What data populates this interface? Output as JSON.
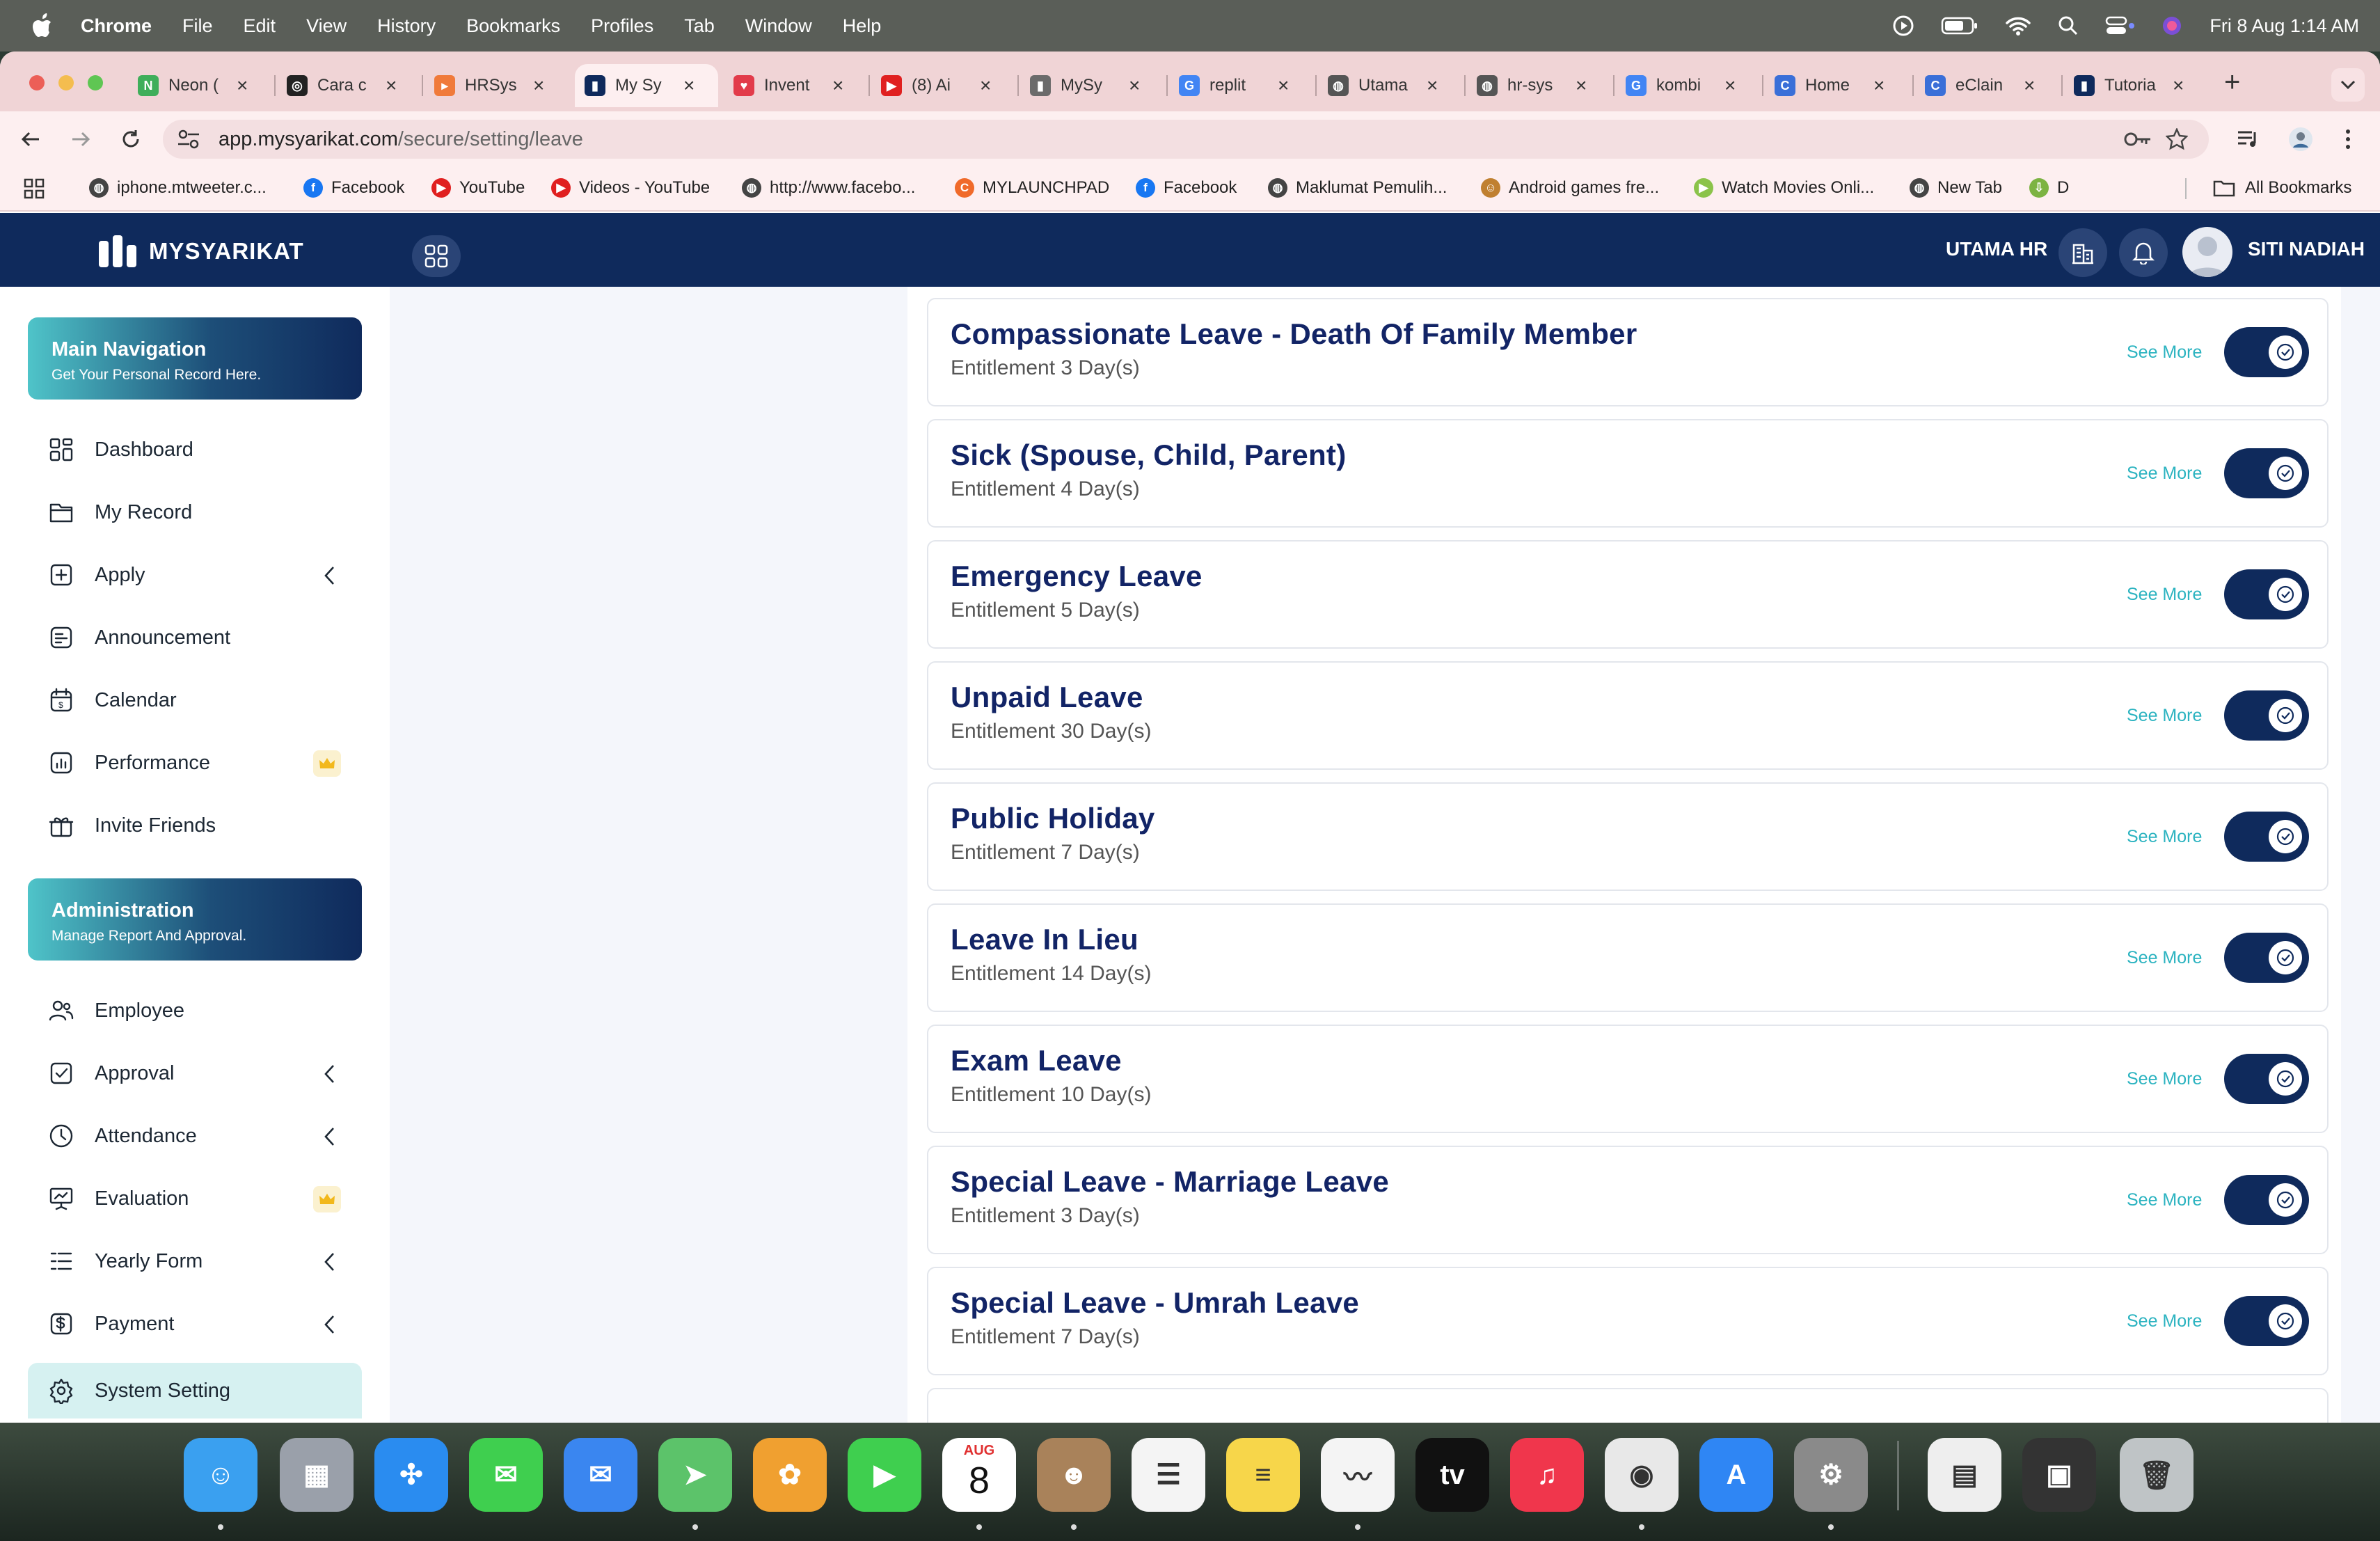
{
  "menubar": {
    "app": "Chrome",
    "items": [
      "File",
      "Edit",
      "View",
      "History",
      "Bookmarks",
      "Profiles",
      "Tab",
      "Window",
      "Help"
    ],
    "clock": "Fri 8 Aug  1:14 AM"
  },
  "tabs": [
    {
      "title": "Neon (",
      "color": "#3fae5a",
      "glyph": "N"
    },
    {
      "title": "Cara c",
      "color": "#222222",
      "glyph": "◎"
    },
    {
      "title": "HRSys",
      "color": "#f07a3a",
      "glyph": "▸"
    },
    {
      "title": "My Sy",
      "color": "#0f2a5c",
      "glyph": "▮"
    },
    {
      "title": "Invent",
      "color": "#e23b4a",
      "glyph": "♥"
    },
    {
      "title": "(8) Ai",
      "color": "#e02020",
      "glyph": "▶"
    },
    {
      "title": "MySy",
      "color": "#6b6b6b",
      "glyph": "▮"
    },
    {
      "title": "replit",
      "color": "#4285f4",
      "glyph": "G"
    },
    {
      "title": "Utama",
      "color": "#555555",
      "glyph": "◍"
    },
    {
      "title": "hr-sys",
      "color": "#555555",
      "glyph": "◍"
    },
    {
      "title": "kombi",
      "color": "#4285f4",
      "glyph": "G"
    },
    {
      "title": "Home",
      "color": "#3a6fd8",
      "glyph": "C"
    },
    {
      "title": "eClain",
      "color": "#3a6fd8",
      "glyph": "C"
    },
    {
      "title": "Tutoria",
      "color": "#0f2a5c",
      "glyph": "▮"
    }
  ],
  "omnibox": {
    "host": "app.mysyarikat.com",
    "path": "/secure/setting/leave"
  },
  "bookmarks": [
    {
      "label": "iphone.mtweeter.c...",
      "color": "#444444",
      "glyph": "◍"
    },
    {
      "label": "Facebook",
      "color": "#1877f2",
      "glyph": "f"
    },
    {
      "label": "YouTube",
      "color": "#e02020",
      "glyph": "▶"
    },
    {
      "label": "Videos - YouTube",
      "color": "#e02020",
      "glyph": "▶"
    },
    {
      "label": "http://www.facebo...",
      "color": "#444444",
      "glyph": "◍"
    },
    {
      "label": "MYLAUNCHPAD",
      "color": "#f06a2a",
      "glyph": "C"
    },
    {
      "label": "Facebook",
      "color": "#1877f2",
      "glyph": "f"
    },
    {
      "label": "Maklumat Pemulih...",
      "color": "#444444",
      "glyph": "◍"
    },
    {
      "label": "Android games fre...",
      "color": "#c08030",
      "glyph": "☺"
    },
    {
      "label": "Watch Movies Onli...",
      "color": "#8bc34a",
      "glyph": "▶"
    },
    {
      "label": "New Tab",
      "color": "#444444",
      "glyph": "◍"
    },
    {
      "label": "D",
      "color": "#7cb342",
      "glyph": "⇩"
    }
  ],
  "all_bookmarks": "All Bookmarks",
  "header": {
    "brand": "MYSYARIKAT",
    "company": "UTAMA HR",
    "user": "SITI NADIAH"
  },
  "sidebar": {
    "main_card": {
      "title": "Main Navigation",
      "subtitle": "Get Your Personal Record Here."
    },
    "main_items": [
      {
        "label": "Dashboard",
        "icon": "dashboard-icon",
        "chevron": false,
        "crown": false
      },
      {
        "label": "My Record",
        "icon": "folder-icon",
        "chevron": false,
        "crown": false
      },
      {
        "label": "Apply",
        "icon": "apply-icon",
        "chevron": true,
        "crown": false
      },
      {
        "label": "Announcement",
        "icon": "announcement-icon",
        "chevron": false,
        "crown": false
      },
      {
        "label": "Calendar",
        "icon": "calendar-icon",
        "chevron": false,
        "crown": false
      },
      {
        "label": "Performance",
        "icon": "performance-icon",
        "chevron": false,
        "crown": true
      },
      {
        "label": "Invite Friends",
        "icon": "gift-icon",
        "chevron": false,
        "crown": false
      }
    ],
    "admin_card": {
      "title": "Administration",
      "subtitle": "Manage Report And Approval."
    },
    "admin_items": [
      {
        "label": "Employee",
        "icon": "users-icon",
        "chevron": false,
        "crown": false
      },
      {
        "label": "Approval",
        "icon": "check-square-icon",
        "chevron": true,
        "crown": false
      },
      {
        "label": "Attendance",
        "icon": "clock-icon",
        "chevron": true,
        "crown": false
      },
      {
        "label": "Evaluation",
        "icon": "presentation-icon",
        "chevron": false,
        "crown": true
      },
      {
        "label": "Yearly Form",
        "icon": "list-icon",
        "chevron": true,
        "crown": false
      },
      {
        "label": "Payment",
        "icon": "dollar-icon",
        "chevron": true,
        "crown": false
      },
      {
        "label": "System Setting",
        "icon": "gear-icon",
        "chevron": false,
        "crown": false,
        "active": true
      }
    ]
  },
  "leave_types": [
    {
      "name": "Compassionate Leave - Death Of Family Member",
      "entitlement": "Entitlement 3 Day(s)",
      "enabled": true
    },
    {
      "name": "Sick (Spouse, Child, Parent)",
      "entitlement": "Entitlement 4 Day(s)",
      "enabled": true
    },
    {
      "name": "Emergency Leave",
      "entitlement": "Entitlement 5 Day(s)",
      "enabled": true
    },
    {
      "name": "Unpaid Leave",
      "entitlement": "Entitlement 30 Day(s)",
      "enabled": true
    },
    {
      "name": "Public Holiday",
      "entitlement": "Entitlement 7 Day(s)",
      "enabled": true
    },
    {
      "name": "Leave In Lieu",
      "entitlement": "Entitlement 14 Day(s)",
      "enabled": true
    },
    {
      "name": "Exam Leave",
      "entitlement": "Entitlement 10 Day(s)",
      "enabled": true
    },
    {
      "name": "Special Leave - Marriage Leave",
      "entitlement": "Entitlement 3 Day(s)",
      "enabled": true
    },
    {
      "name": "Special Leave - Umrah Leave",
      "entitlement": "Entitlement 7 Day(s)",
      "enabled": true
    }
  ],
  "see_more_label": "See More",
  "dock": [
    {
      "name": "Finder",
      "color": "#3aa0f0",
      "glyph": "☺",
      "running": true
    },
    {
      "name": "Launchpad",
      "color": "#9aa0aa",
      "glyph": "▦",
      "running": false
    },
    {
      "name": "Safari",
      "color": "#2a8cf0",
      "glyph": "✣",
      "running": false
    },
    {
      "name": "Messages",
      "color": "#3fcf4f",
      "glyph": "✉",
      "running": false
    },
    {
      "name": "Mail",
      "color": "#3a86f0",
      "glyph": "✉",
      "running": false
    },
    {
      "name": "Maps",
      "color": "#5cc36a",
      "glyph": "➤",
      "running": true
    },
    {
      "name": "Photos",
      "color": "#f0a030",
      "glyph": "✿",
      "running": false
    },
    {
      "name": "FaceTime",
      "color": "#3fcf4f",
      "glyph": "▶",
      "running": false
    },
    {
      "name": "Calendar",
      "color": "#ffffff",
      "glyph": "8",
      "running": true
    },
    {
      "name": "Contacts",
      "color": "#a9825a",
      "glyph": "☻",
      "running": true
    },
    {
      "name": "Reminders",
      "color": "#f4f4f4",
      "glyph": "☰",
      "running": false
    },
    {
      "name": "Notes",
      "color": "#f7d64a",
      "glyph": "≡",
      "running": false
    },
    {
      "name": "Freeform",
      "color": "#f4f4f4",
      "glyph": "〰",
      "running": true
    },
    {
      "name": "TV",
      "color": "#111111",
      "glyph": "tv",
      "running": false
    },
    {
      "name": "Music",
      "color": "#f0364c",
      "glyph": "♫",
      "running": false
    },
    {
      "name": "Chrome",
      "color": "#e8e8e8",
      "glyph": "◉",
      "running": true
    },
    {
      "name": "App Store",
      "color": "#2f86f4",
      "glyph": "A",
      "running": false
    },
    {
      "name": "System Settings",
      "color": "#8a8a8a",
      "glyph": "⚙",
      "running": true
    },
    {
      "name": "Preview",
      "color": "#eeeeee",
      "glyph": "▤",
      "running": false
    },
    {
      "name": "Screenshot",
      "color": "#333333",
      "glyph": "▣",
      "running": false
    },
    {
      "name": "Trash",
      "color": "#bfc4c6",
      "glyph": "🗑",
      "running": false
    }
  ],
  "dock_calendar_month": "AUG",
  "dock_calendar_day": "8"
}
